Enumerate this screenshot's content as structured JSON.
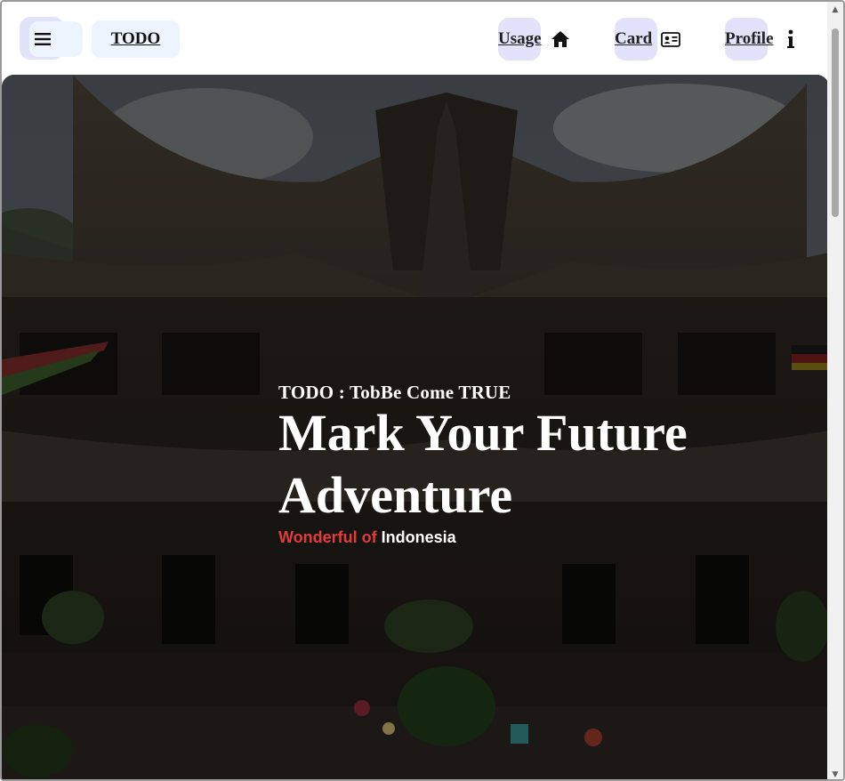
{
  "header": {
    "brand": "TODO",
    "nav": [
      {
        "label": "Usage",
        "icon": "home-icon"
      },
      {
        "label": "Card",
        "icon": "id-card-icon"
      },
      {
        "label": "Profile",
        "icon": "info-icon"
      }
    ]
  },
  "hero": {
    "kicker": "TODO : TobBe Come TRUE",
    "headline_line1": "Mark Your Future",
    "headline_line2": "Adventure",
    "tagline_red": "Wonderful of",
    "tagline_white": "Indonesia"
  },
  "colors": {
    "accent_red": "#e23b3b",
    "nav_pill": "#e2e3fb",
    "brand_pill": "#eef4fd"
  }
}
